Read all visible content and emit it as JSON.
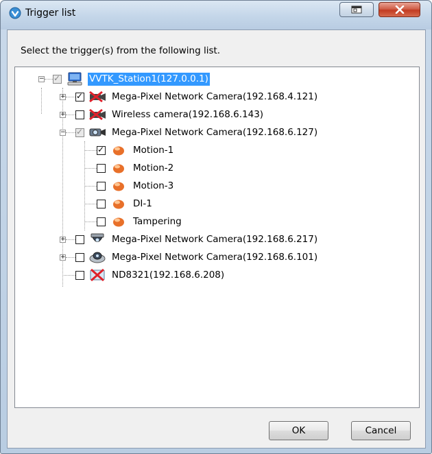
{
  "window": {
    "title": "Trigger list"
  },
  "instruction": "Select the trigger(s) from the following list.",
  "tree": {
    "station": {
      "label": "VVTK_Station1(127.0.0.1)"
    },
    "cam1": {
      "label": "Mega-Pixel Network Camera(192.168.4.121)"
    },
    "cam2": {
      "label": "Wireless camera(192.168.6.143)"
    },
    "cam3": {
      "label": "Mega-Pixel Network Camera(192.168.6.127)"
    },
    "trig1": {
      "label": "Motion-1"
    },
    "trig2": {
      "label": "Motion-2"
    },
    "trig3": {
      "label": "Motion-3"
    },
    "trig4": {
      "label": "DI-1"
    },
    "trig5": {
      "label": "Tampering"
    },
    "cam4": {
      "label": "Mega-Pixel Network Camera(192.168.6.217)"
    },
    "cam5": {
      "label": "Mega-Pixel Network Camera(192.168.6.101)"
    },
    "cam6": {
      "label": "ND8321(192.168.6.208)"
    }
  },
  "buttons": {
    "ok": "OK",
    "cancel": "Cancel"
  },
  "colors": {
    "selection": "#3399ff",
    "close": "#c23b22"
  }
}
